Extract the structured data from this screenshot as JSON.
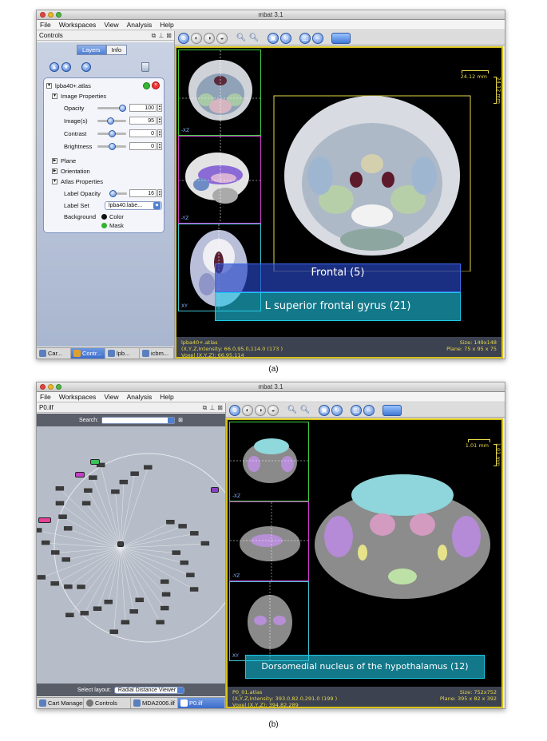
{
  "panel_a": {
    "app_title": "mbat 3.1",
    "menu": [
      "File",
      "Workspaces",
      "View",
      "Analysis",
      "Help"
    ],
    "left_panel_title": "Controls",
    "segments": [
      "Layers",
      "Info"
    ],
    "layer_name": "lpba40+.atlas",
    "image_properties_label": "Image Properties",
    "props": [
      {
        "label": "Opacity",
        "value": "100",
        "level": 0.85
      },
      {
        "label": "Image(s)",
        "value": "95",
        "level": 0.45
      },
      {
        "label": "Contrast",
        "value": "0",
        "level": 0.5
      },
      {
        "label": "Brightness",
        "value": "0",
        "level": 0.5
      }
    ],
    "plane_label": "Plane",
    "orientation_label": "Orientation",
    "atlas_properties_label": "Atlas Properties",
    "label_opacity_label": "Label Opacity",
    "label_opacity_value": "16",
    "label_set_label": "Label Set",
    "label_set_value": "lpba40.labe...",
    "background_label": "Background",
    "bg_options": [
      "Color",
      "Mask"
    ],
    "tabs": [
      "Car...",
      "Contr...",
      "lpb...",
      "icbm..."
    ],
    "thumb_axes": [
      "-XZ",
      "-YZ",
      "XY"
    ],
    "scale_h": "24.12 mm",
    "scale_v": "24.12 mm",
    "label_outer": "Frontal (5)",
    "label_inner": "L superior frontal gyrus (21)",
    "footer_line1": "lpba40+.atlas",
    "footer_line2": "(X,Y,Z,Intensity: 66.0,95.0,114.0  (173 )",
    "footer_line3": "Voxel (X,Y,Z): 66,95,114",
    "footer_size": "Size: 149x148",
    "footer_plane": "Plane: 75 x 95 x 75",
    "caption": "(a)"
  },
  "panel_b": {
    "app_title": "mbat 3.1",
    "menu": [
      "File",
      "Workspaces",
      "View",
      "Analysis",
      "Help"
    ],
    "left_panel_title": "P0.ilf",
    "search_label": "Search:",
    "layout_label": "Select layout:",
    "layout_value": "Radial Distance Viewer",
    "tabs": [
      "Cart Manager",
      "Controls",
      "MDA2006.ilf",
      "P0.ilf"
    ],
    "thumb_axes": [
      "-XZ",
      "-YZ",
      "XY"
    ],
    "scale_h": "1.01 mm",
    "scale_v": "1.01 mm",
    "label_inner": "Dorsomedial nucleus of the hypothalamus (12)",
    "footer_line1": "P0_01.atlas",
    "footer_line2": "(X,Y,Z,Intensity: 393.0,82.0,291.0  (199 )",
    "footer_line3": "Voxel (X,Y,Z): 394,82,289",
    "footer_size": "Size: 752x752",
    "footer_plane": "Plane: 395 x 82 x 392",
    "caption": "(b)"
  },
  "colors": {
    "accent_blue": "#3f78d6",
    "viewer_border": "#d6c21c",
    "label_cyan": "#1ec8e6",
    "thumb_green": "#3fd13f",
    "thumb_magenta": "#d33fd3",
    "thumb_cyan": "#3fc7d6"
  }
}
